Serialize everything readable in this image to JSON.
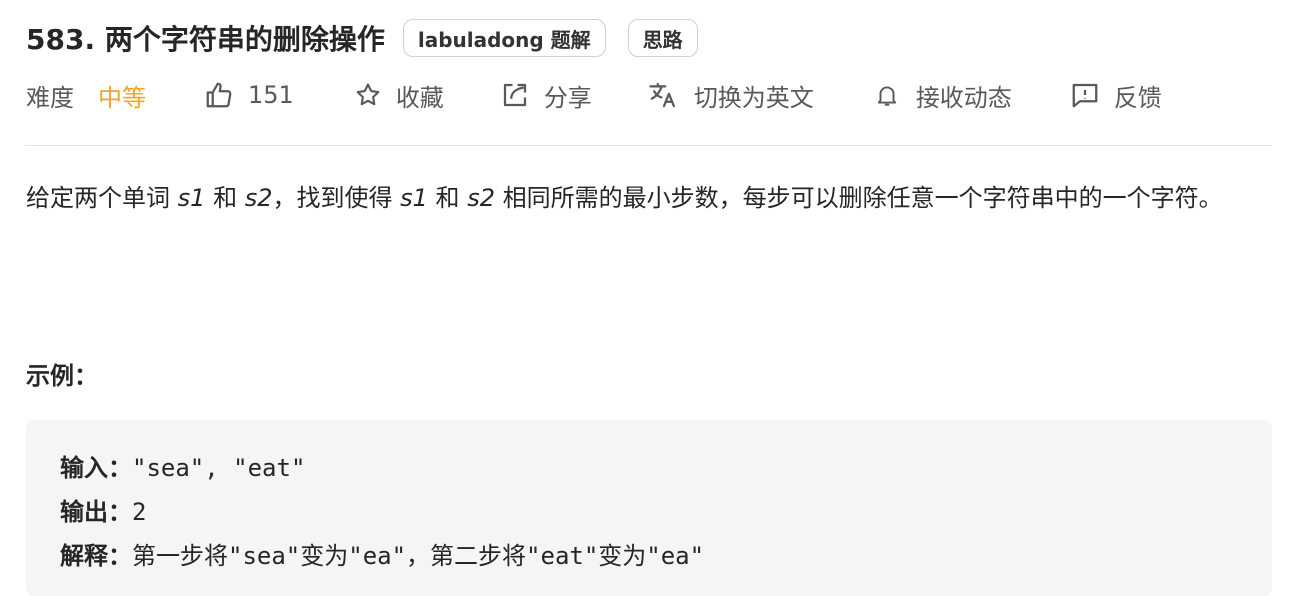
{
  "title": "583. 两个字符串的删除操作",
  "tags": [
    "labuladong 题解",
    "思路"
  ],
  "meta": {
    "difficulty_label": "难度",
    "difficulty_value": "中等",
    "likes": "151",
    "favorite": "收藏",
    "share": "分享",
    "translate": "切换为英文",
    "subscribe": "接收动态",
    "feedback": "反馈"
  },
  "description": {
    "p1": "给定两个单词",
    "s1": "s1",
    "p2": "和",
    "s2": "s2",
    "p3": "，找到使得",
    "s1b": "s1",
    "p4": "和",
    "s2b": "s2",
    "p5": "相同所需的最小步数，每步可以删除任意一个字符串中的一个字符。"
  },
  "example": {
    "title": "示例：",
    "input_label": "输入：",
    "input_value": "\"sea\", \"eat\"",
    "output_label": "输出：",
    "output_value": "2",
    "explain_label": "解释：",
    "explain_value": "第一步将\"sea\"变为\"ea\"，第二步将\"eat\"变为\"ea\""
  },
  "colors": {
    "difficulty": "#f5a623",
    "code_bg": "#f5f5f5"
  },
  "icons": [
    "thumbs-up-icon",
    "star-icon",
    "share-icon",
    "translate-icon",
    "bell-icon",
    "feedback-icon"
  ]
}
